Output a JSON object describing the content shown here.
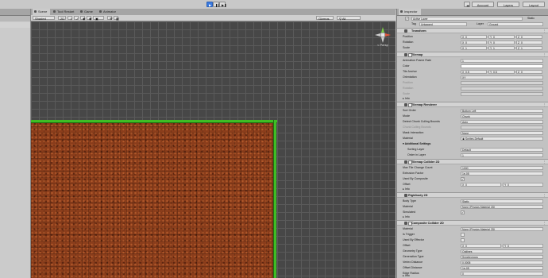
{
  "toolbar": {
    "account": "Account",
    "layers": "Layers",
    "layout": "Layout"
  },
  "scene_tabs": [
    "Scene",
    "Tool Restart",
    "Game",
    "Animator"
  ],
  "scene_bar": {
    "shading": "Shaded",
    "mode_2d": "2D",
    "gizmos": "Gizmos",
    "search": "All"
  },
  "scene_view": {
    "persp_label": "< Persp"
  },
  "inspector": {
    "tab": "Inspector",
    "object_name": "Active Layer",
    "static_label": "Static",
    "tag_label": "Tag",
    "tag_value": "Untagged",
    "layer_label": "Layer",
    "layer_value": "Ground",
    "transform": {
      "title": "Transform",
      "rows": [
        {
          "label": "Position",
          "x": "0",
          "y": "0",
          "z": "0"
        },
        {
          "label": "Rotation",
          "x": "0",
          "y": "0",
          "z": "0"
        },
        {
          "label": "Scale",
          "x": "1",
          "y": "1",
          "z": "1"
        }
      ]
    },
    "tilemap": {
      "title": "Tilemap",
      "animation_label": "Animation Frame Rate",
      "animation_value": "1",
      "color_label": "Color",
      "anchor_label": "Tile Anchor",
      "anchor_x": "0.5",
      "anchor_y": "0.5",
      "anchor_z": "0",
      "orientation_label": "Orientation",
      "orientation_value": "XY",
      "position_label": "Position",
      "rotation_label": "Rotation",
      "scale_label": "Scale",
      "info_label": "Info"
    },
    "tilemap_renderer": {
      "title": "Tilemap Renderer",
      "sort_order_label": "Sort Order",
      "sort_order_value": "Bottom Left",
      "mode_label": "Mode",
      "mode_value": "Chunk",
      "detect_label": "Detect Chunk Culling Bounds",
      "detect_value": "Auto",
      "chunk_label": "Chunk Culling Bounds",
      "mask_label": "Mask Interaction",
      "mask_value": "None",
      "material_label": "Material",
      "material_value": "Sprites-Default",
      "additional": "Additional Settings",
      "sorting_layer_label": "Sorting Layer",
      "sorting_layer_value": "Default",
      "order_label": "Order in Layer",
      "order_value": "1"
    },
    "tilemap_collider": {
      "title": "Tilemap Collider 2D",
      "max_label": "Max Tile Change Count",
      "max_value": "1000",
      "extrusion_label": "Extrusion Factor",
      "extrusion_value": "1e-05",
      "composite_label": "Used By Composite",
      "offset_label": "Offset",
      "offset_x": "0",
      "offset_y": "0",
      "info_label": "Info"
    },
    "rigidbody": {
      "title": "Rigidbody 2D",
      "body_type_label": "Body Type",
      "body_type_value": "Static",
      "material_label": "Material",
      "material_value": "None (Physics Material 2D)",
      "simulated_label": "Simulated",
      "info_label": "Info"
    },
    "composite_collider": {
      "title": "Composite Collider 2D",
      "material_label": "Material",
      "material_value": "None (Physics Material 2D)",
      "trigger_label": "Is Trigger",
      "effector_label": "Used By Effector",
      "offset_label": "Offset",
      "offset_x": "0",
      "offset_y": "0",
      "geometry_label": "Geometry Type",
      "geometry_value": "Outlines",
      "generation_label": "Generation Type",
      "generation_value": "Synchronous",
      "vertex_label": "Vertex Distance",
      "vertex_value": "0.0005",
      "offset_distance_label": "Offset Distance",
      "offset_distance_value": "1e-05",
      "edge_label": "Edge Radius",
      "edge_value": "0",
      "info_label": "Info"
    }
  },
  "colors": {
    "accent": "#3c7be0",
    "grass": "#3fbd25",
    "dirt": "#8a3d1b",
    "viewport": "#474747"
  }
}
